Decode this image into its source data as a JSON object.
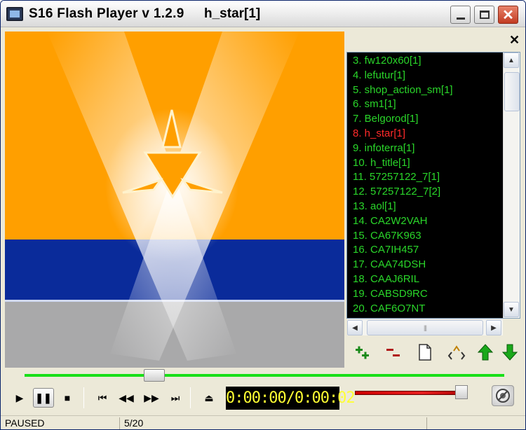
{
  "window": {
    "title": "S16 Flash Player v 1.2.9",
    "current_file": "h_star[1]"
  },
  "colors": {
    "orange": "#ff9f00",
    "blue": "#0a2b9a",
    "gray": "#a9a9aa",
    "playlist_text": "#2ad62a",
    "playlist_active": "#ff2a2a",
    "time_text": "#ffff33",
    "seek_track": "#19e019",
    "volume_track": "#e82020"
  },
  "playlist": {
    "close_glyph": "✕",
    "items": [
      {
        "label": "3. fw120x60[1]",
        "active": false
      },
      {
        "label": "4. lefutur[1]",
        "active": false
      },
      {
        "label": "5. shop_action_sm[1]",
        "active": false
      },
      {
        "label": "6. sm1[1]",
        "active": false
      },
      {
        "label": "7. Belgorod[1]",
        "active": false
      },
      {
        "label": "8. h_star[1]",
        "active": true
      },
      {
        "label": "9. infoterra[1]",
        "active": false
      },
      {
        "label": "10. h_title[1]",
        "active": false
      },
      {
        "label": "11. 57257122_7[1]",
        "active": false
      },
      {
        "label": "12. 57257122_7[2]",
        "active": false
      },
      {
        "label": "13. aol[1]",
        "active": false
      },
      {
        "label": "14. CA2W2VAH",
        "active": false
      },
      {
        "label": "15. CA67K963",
        "active": false
      },
      {
        "label": "16. CA7IH457",
        "active": false
      },
      {
        "label": "17. CAA74DSH",
        "active": false
      },
      {
        "label": "18. CAAJ6RIL",
        "active": false
      },
      {
        "label": "19. CABSD9RC",
        "active": false
      },
      {
        "label": "20. CAF6O7NT",
        "active": false
      }
    ],
    "tools": [
      "add-icon",
      "remove-icon",
      "new-file-icon",
      "shuffle-icon",
      "move-up-icon",
      "move-down-icon"
    ]
  },
  "playback": {
    "seek_fraction": 0.27,
    "volume_fraction": 0.95,
    "time_display": "0:00:00/0:00:02",
    "state": "paused"
  },
  "status": {
    "state_text": "PAUSED",
    "position": "5/20"
  }
}
